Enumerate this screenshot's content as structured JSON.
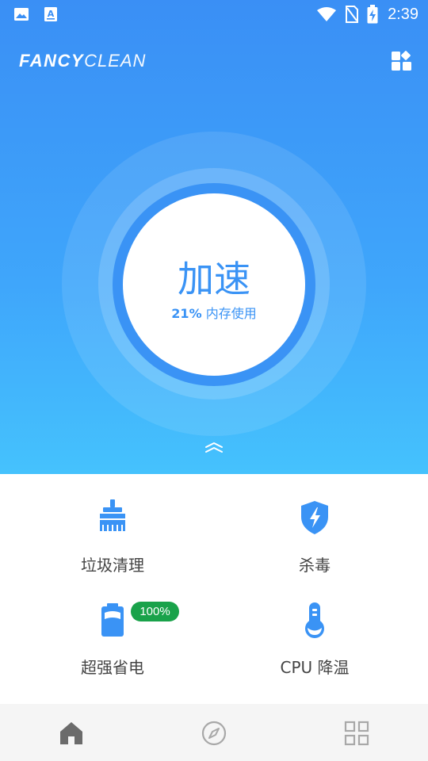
{
  "status_bar": {
    "time": "2:39",
    "icons": [
      "image-notification-icon",
      "a-notification-icon",
      "wifi-icon",
      "no-sim-icon",
      "battery-charging-icon"
    ]
  },
  "app_bar": {
    "logo_bold": "FANCY",
    "logo_light": "CLEAN",
    "apps_icon": "apps-grid-icon"
  },
  "boost": {
    "title": "加速",
    "memory_percent": "21%",
    "memory_label": "内存使用"
  },
  "features": [
    {
      "label": "垃圾清理",
      "icon": "broom-icon"
    },
    {
      "label": "杀毒",
      "icon": "shield-bolt-icon"
    },
    {
      "label": "超强省电",
      "icon": "battery-icon",
      "badge": "100%"
    },
    {
      "label": "CPU 降温",
      "icon": "thermometer-icon"
    }
  ],
  "bottom_nav": [
    {
      "name": "home",
      "icon": "home-icon",
      "active": true
    },
    {
      "name": "discover",
      "icon": "compass-icon",
      "active": false
    },
    {
      "name": "more",
      "icon": "grid-icon",
      "active": false
    }
  ],
  "colors": {
    "primary": "#3a93f5",
    "gradient_top": "#3a8ff5",
    "gradient_bottom": "#45c2fd",
    "badge_green": "#19a24a",
    "nav_bg": "#f5f5f5"
  }
}
